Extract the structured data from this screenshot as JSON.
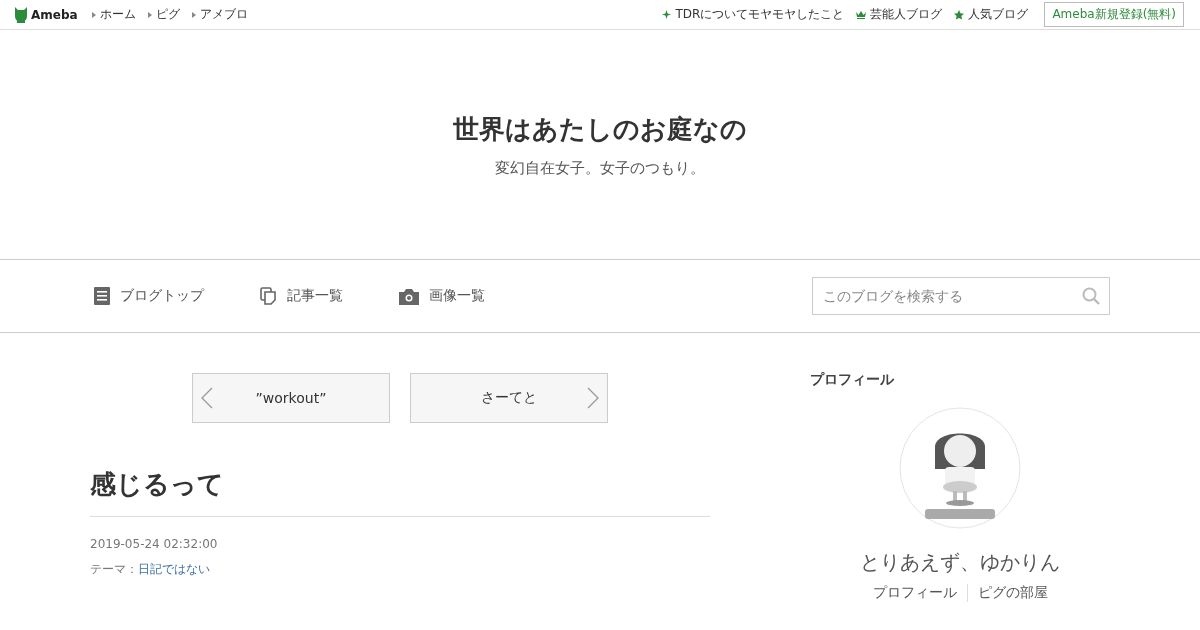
{
  "topbar": {
    "logo": "Ameba",
    "links": [
      "ホーム",
      "ピグ",
      "アメブロ"
    ],
    "right_links": [
      {
        "kind": "sparkle",
        "label": "TDRについてモヤモヤしたこと"
      },
      {
        "kind": "crown",
        "label": "芸能人ブログ"
      },
      {
        "kind": "star",
        "label": "人気ブログ"
      }
    ],
    "signup": "Ameba新規登録(無料)"
  },
  "header": {
    "title": "世界はあたしのお庭なの",
    "subtitle": "変幻自在女子。女子のつもり。"
  },
  "nav": {
    "items": [
      {
        "kind": "list",
        "label": "ブログトップ"
      },
      {
        "kind": "copy",
        "label": "記事一覧"
      },
      {
        "kind": "camera",
        "label": "画像一覧"
      }
    ],
    "search_placeholder": "このブログを検索する"
  },
  "pager": {
    "prev": "”workout”",
    "next": "さーてと"
  },
  "entry": {
    "title": "感じるって",
    "date": "2019-05-24 02:32:00",
    "theme_label": "テーマ：",
    "theme": "日記ではない"
  },
  "profile": {
    "heading": "プロフィール",
    "avatar": {
      "kind": "picture"
    },
    "name": "とりあえず、ゆかりん",
    "links": [
      "プロフィール",
      "ピグの部屋"
    ]
  }
}
